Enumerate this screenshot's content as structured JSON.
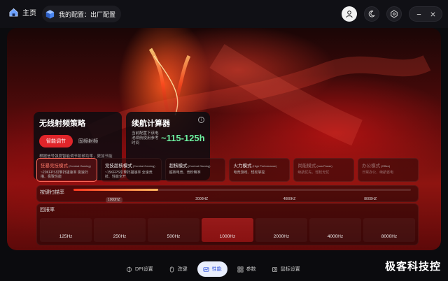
{
  "topbar": {
    "home_label": "主页",
    "config_label": "我的配置：出厂配置"
  },
  "wireless_card": {
    "title": "无线射频策略",
    "smart_button": "智能调节",
    "fixed_option": "固频射频",
    "desc": "根据信号强度智能调节射频功率，更加节能"
  },
  "battery_card": {
    "title": "续航计算器",
    "info_symbol": "i",
    "small_text": "当前配置下该电池续航使用参考时间",
    "range": "~115-125h"
  },
  "modes": [
    {
      "title": "狂暴竞技模式",
      "en": "(Combat Gaming)",
      "desc": "~20KFPS引擎扫描速率 极速扫描、极致性能",
      "active": true
    },
    {
      "title": "竞技超核模式",
      "en": "(Combat Gaming)",
      "desc": "~15KFPS引擎扫描速率 全速竞技、性能全开",
      "active": false
    },
    {
      "title": "超核模式",
      "en": "(Combat Gaming)",
      "desc": "超核电竞、竞秒精准",
      "active": false
    },
    {
      "title": "火力模式",
      "en": "(High Performance)",
      "desc": "电竞游戏、轻松掌控",
      "active": false
    },
    {
      "title": "尚能模式",
      "en": "(Low Power)",
      "desc": "续航优先、轻松无忧",
      "dim": true
    },
    {
      "title": "办公模式",
      "en": "(Office)",
      "desc": "日常办公、续航省电",
      "dim": true
    }
  ],
  "scan_rate": {
    "label": "按键扫描率",
    "ticks": [
      "1000HZ",
      "2000HZ",
      "4000HZ",
      "8000HZ"
    ],
    "selected": "1000HZ",
    "fill_fraction": 0.25
  },
  "polling": {
    "label": "回报率",
    "options": [
      "125Hz",
      "250Hz",
      "500Hz",
      "1000Hz",
      "2000Hz",
      "4000Hz",
      "8000Hz"
    ],
    "selected": "1000Hz"
  },
  "bottom_nav": [
    {
      "label": "DPI设置",
      "icon": "crosshair-icon"
    },
    {
      "label": "改键",
      "icon": "mouse-icon"
    },
    {
      "label": "性能",
      "icon": "performance-icon",
      "active": true
    },
    {
      "label": "参数",
      "icon": "grid-icon"
    },
    {
      "label": "鼠标设置",
      "icon": "settings-icon"
    }
  ],
  "watermark": "极客科技控"
}
